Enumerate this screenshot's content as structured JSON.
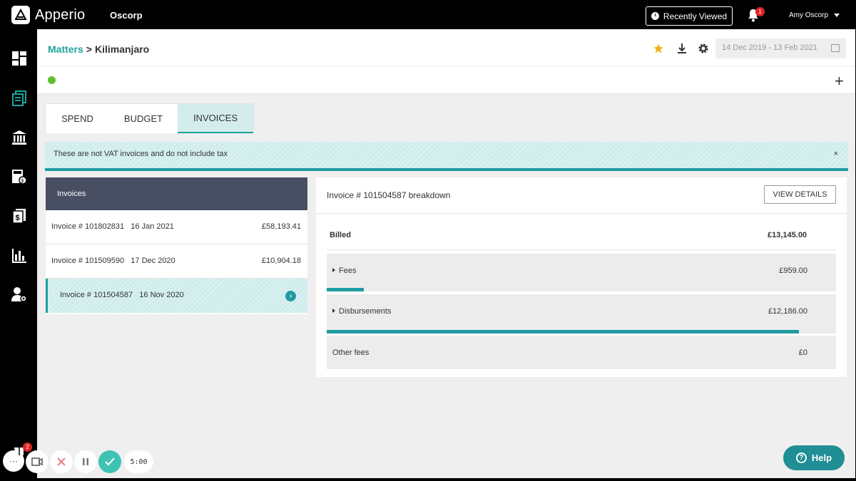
{
  "app": {
    "name": "Apperio",
    "org": "Oscorp"
  },
  "topbar": {
    "recent_label": "Recently Viewed",
    "notifications": "1",
    "user": "Amy Oscorp"
  },
  "breadcrumb": {
    "root": "Matters",
    "sep": ">",
    "current": "Kilimanjaro"
  },
  "date_range": "14 Dec 2019 - 13 Feb 2021",
  "tabs": [
    {
      "label": "SPEND"
    },
    {
      "label": "BUDGET"
    },
    {
      "label": "INVOICES",
      "active": true
    }
  ],
  "banner": {
    "message": "These are not VAT invoices and do not include tax",
    "close": "×"
  },
  "invoices": {
    "title": "Invoices",
    "rows": [
      {
        "label": "Invoice # 101802831   16 Jan 2021",
        "amount": "£58,193.41"
      },
      {
        "label": "Invoice # 101509590   17 Dec 2020",
        "amount": "£10,904.18"
      },
      {
        "label": "Invoice # 101504587   16 Nov 2020",
        "amount": "",
        "selected": true
      }
    ]
  },
  "breakdown": {
    "title": "Invoice # 101504587 breakdown",
    "view_details": "VIEW DETAILS",
    "billed_label": "Billed",
    "billed_amount": "£13,145.00",
    "rows": [
      {
        "label": "Fees",
        "amount": "£959.00",
        "share": 0.073,
        "expandable": true
      },
      {
        "label": "Disbursements",
        "amount": "£12,186.00",
        "share": 0.927,
        "expandable": true
      },
      {
        "label": "Other fees",
        "amount": "£0",
        "share": 0,
        "expandable": false
      }
    ]
  },
  "toolbar": {
    "timer": "5:00",
    "gift_badge": "2"
  },
  "help": {
    "label": "Help",
    "icon": "?"
  },
  "colors": {
    "accent": "#1f9ba2",
    "header_dark": "#484f63",
    "status_green": "#5fbf2b"
  }
}
